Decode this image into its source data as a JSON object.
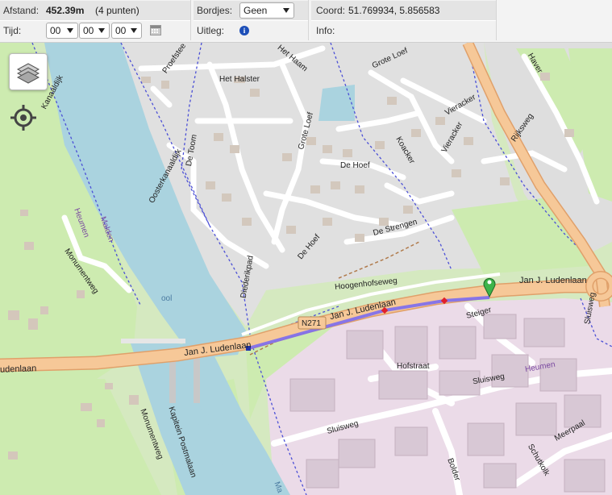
{
  "toolbar": {
    "distance_label": "Afstand:",
    "distance_value": "452.39m",
    "distance_points": "(4 punten)",
    "time_label": "Tijd:",
    "time_hours": "00",
    "time_minutes": "00",
    "time_seconds": "00",
    "signs_label": "Bordjes:",
    "signs_value": "Geen",
    "explain_label": "Uitleg:",
    "coord_label": "Coord:",
    "coord_value": "51.769934, 5.856583",
    "info_label": "Info:"
  },
  "map": {
    "labels": {
      "jan_ludenlaan_1": "Jan J. Ludenlaan",
      "jan_ludenlaan_2": "Jan J. Ludenlaan",
      "jan_ludenlaan_3": "Jan J. Ludenlaan",
      "jan_ludenlaan_4": "Jan J. Ludenlaan",
      "ludenlaan_left": "udenlaan",
      "n271": "N271",
      "hoogenhofseweg": "Hoogenhofseweg",
      "de_strengen": "De Strengen",
      "de_hoef_1": "De Hoef",
      "de_hoef_2": "De Hoef",
      "grote_loef": "Grote Loef",
      "grote_loef_top": "Grote Loef",
      "het_halster": "Het Halster",
      "het_haam": "Het Haam",
      "de_toom": "De Toom",
      "koacker": "Koacker",
      "vieracker_1": "Vieracker",
      "vieracker_2": "Vieracker",
      "rijksweg": "Rijksweg",
      "haver": "Haver",
      "proefstee": "Proefstee",
      "oosterkanaaldijk": "Oosterkanaaldijk",
      "kanaaldijk": "Kanaaldijk",
      "heumen_1": "Heumen",
      "heumen_2": "Heumen",
      "malden": "Malden",
      "monumentweg_1": "Monumentweg",
      "monumentweg_2": "Monumentweg",
      "diederikpad": "Diederikpad",
      "kapitein_postmalaan": "Kapitein Postmalaan",
      "hofstraat": "Hofstraat",
      "sluisweg_1": "Sluisweg",
      "sluisweg_2": "Sluisweg",
      "steiger": "Steiger",
      "bolder": "Bolder",
      "meerpaal": "Meerpaal",
      "schutkolk": "Schutkolk",
      "sluisweg_right": "Sluisweg",
      "ool": "ool",
      "ma": "Ma"
    },
    "colors": {
      "route": "#7b6cf0",
      "marker": "#3cb44b",
      "waypoint": "#e0202a",
      "main_road": "#f6c898",
      "water": "#aad3df",
      "residential": "#e0e0e0",
      "industrial": "#ebdbe8",
      "grass": "#cdebb0"
    },
    "buttons": {
      "layers_icon": "layers-icon",
      "locate_icon": "crosshair-icon"
    }
  }
}
